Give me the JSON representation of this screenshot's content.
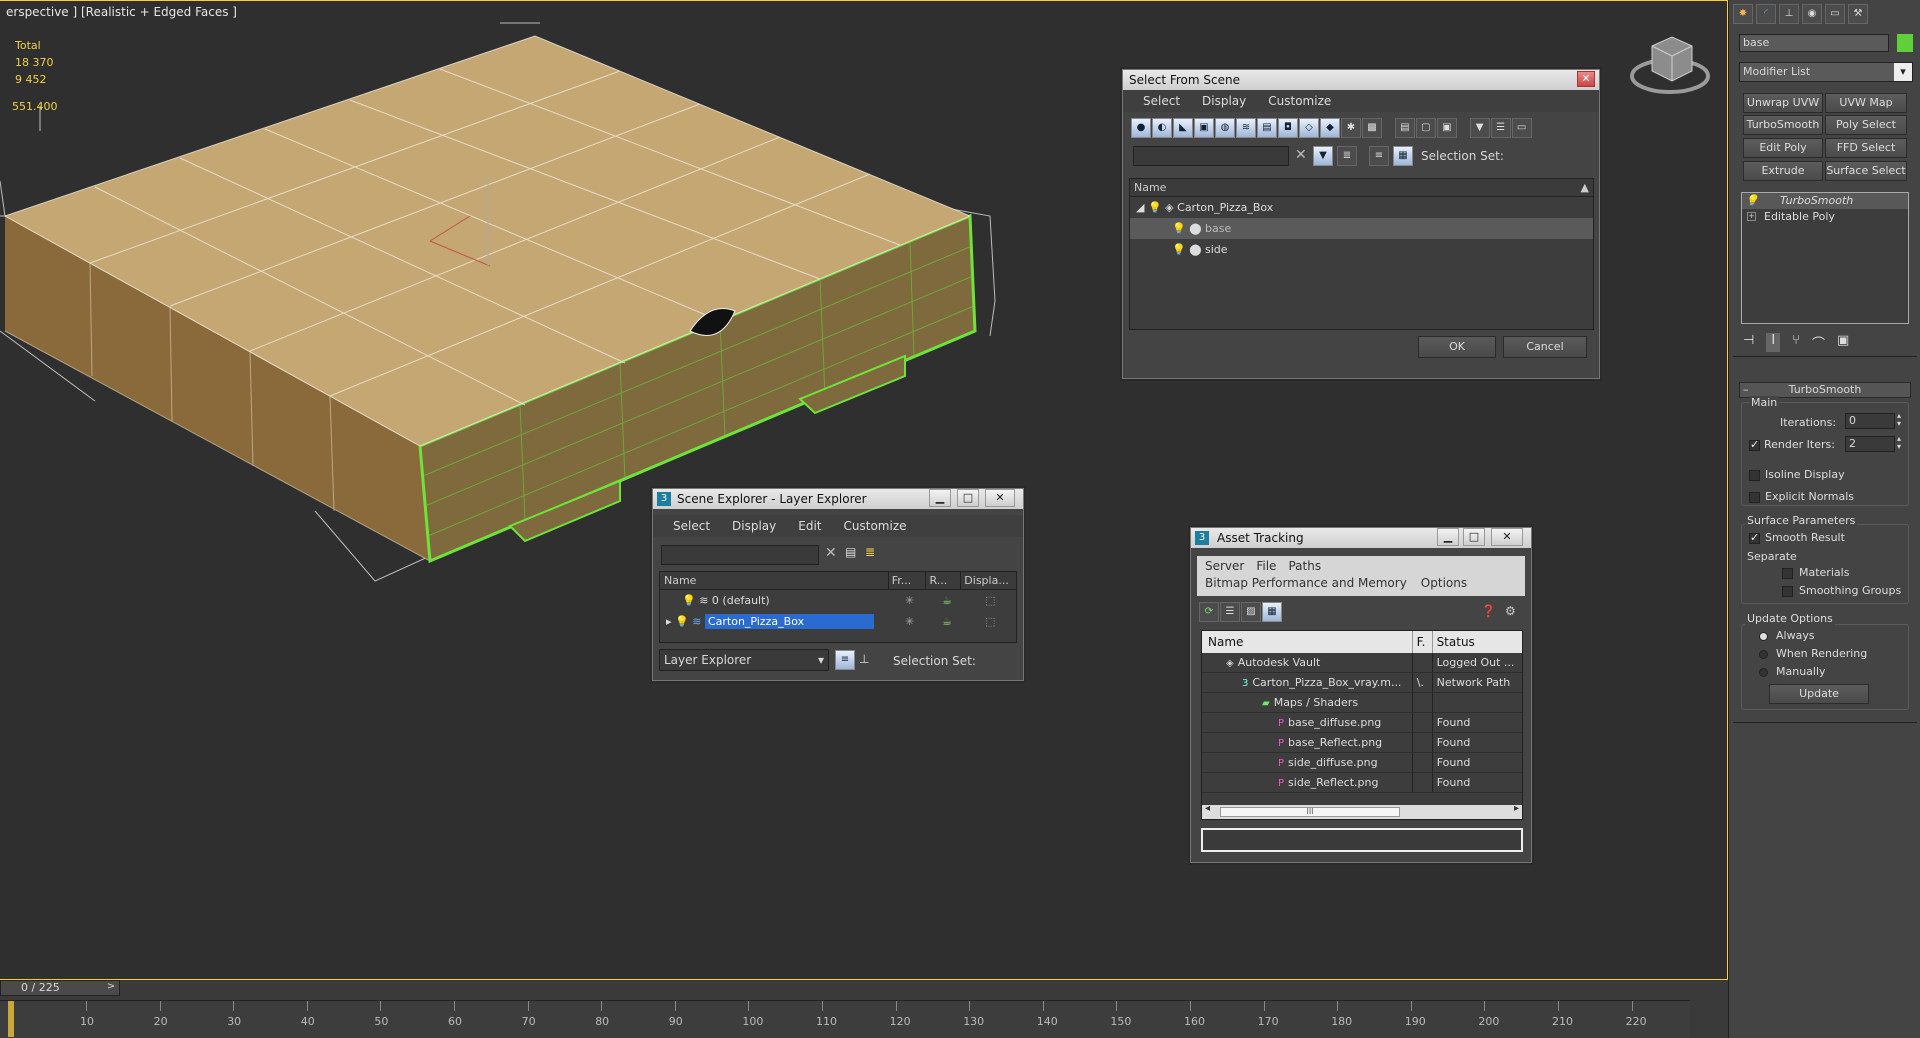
{
  "viewport": {
    "label": "erspective ] [Realistic + Edged Faces ]",
    "stats": {
      "total_label": "Total",
      "v1": "18 370",
      "v2": "9 452",
      "v3": "551.400"
    }
  },
  "select_from_scene": {
    "title": "Select From Scene",
    "menu": [
      "Select",
      "Display",
      "Customize"
    ],
    "selection_set_label": "Selection Set:",
    "column_name": "Name",
    "tree": [
      "Carton_Pizza_Box",
      "base",
      "side"
    ],
    "ok": "OK",
    "cancel": "Cancel"
  },
  "scene_explorer": {
    "title": "Scene Explorer - Layer Explorer",
    "menu": [
      "Select",
      "Display",
      "Edit",
      "Customize"
    ],
    "columns": [
      "Name",
      "Fr...",
      "R...",
      "Displa..."
    ],
    "rows": [
      "0 (default)",
      "Carton_Pizza_Box"
    ],
    "dropdown": "Layer Explorer",
    "selection_set_label": "Selection Set:"
  },
  "asset_tracking": {
    "title": "Asset Tracking",
    "menu1": [
      "Server",
      "File",
      "Paths"
    ],
    "menu2": [
      "Bitmap Performance and Memory",
      "Options"
    ],
    "columns": [
      "Name",
      "F.",
      "Status"
    ],
    "rows": [
      {
        "name": "Autodesk Vault",
        "f": "",
        "status": "Logged Out ..."
      },
      {
        "name": "Carton_Pizza_Box_vray.m...",
        "f": "\\.",
        "status": "Network Path"
      },
      {
        "name": "Maps / Shaders",
        "f": "",
        "status": ""
      },
      {
        "name": "base_diffuse.png",
        "f": "",
        "status": "Found"
      },
      {
        "name": "base_Reflect.png",
        "f": "",
        "status": "Found"
      },
      {
        "name": "side_diffuse.png",
        "f": "",
        "status": "Found"
      },
      {
        "name": "side_Reflect.png",
        "f": "",
        "status": "Found"
      }
    ],
    "scroll_grip": "III"
  },
  "panel": {
    "object_name": "base",
    "modifier_list": "Modifier List",
    "mod_buttons": [
      "Unwrap UVW",
      "UVW Map",
      "TurboSmooth",
      "Poly Select",
      "Edit Poly",
      "FFD Select",
      "Extrude",
      "Surface Select"
    ],
    "stack": [
      "TurboSmooth",
      "Editable Poly"
    ],
    "rollout_title": "TurboSmooth",
    "main_label": "Main",
    "iterations_label": "Iterations:",
    "iterations": "0",
    "render_iters_label": "Render Iters:",
    "render_iters": "2",
    "isoline": "Isoline Display",
    "explicit_normals": "Explicit Normals",
    "surface_params": "Surface Parameters",
    "smooth_result": "Smooth Result",
    "separate": "Separate",
    "materials": "Materials",
    "smoothing_groups": "Smoothing Groups",
    "update_options": "Update Options",
    "always": "Always",
    "when_rendering": "When Rendering",
    "manually": "Manually",
    "update": "Update",
    "colors": {
      "swatch": "#5fcf3a"
    }
  },
  "timeline": {
    "frame": "0 / 225",
    "ticks": [
      "10",
      "20",
      "30",
      "40",
      "50",
      "60",
      "70",
      "80",
      "90",
      "100",
      "110",
      "120",
      "130",
      "140",
      "150",
      "160",
      "170",
      "180",
      "190",
      "200",
      "210",
      "220"
    ]
  }
}
